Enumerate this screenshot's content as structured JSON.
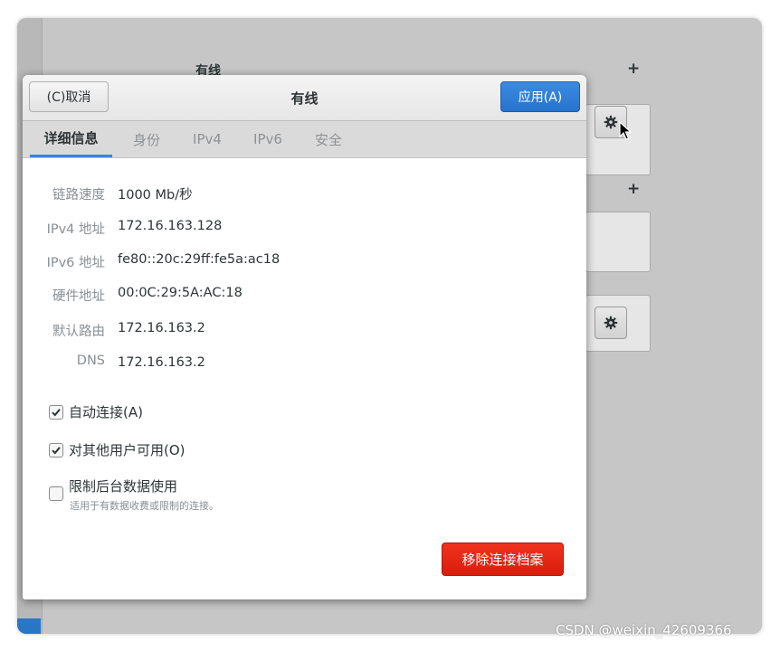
{
  "background": {
    "section_title": "有线",
    "plus_symbol": "+"
  },
  "dialog": {
    "title": "有线",
    "cancel_label": "(C)取消",
    "apply_label": "应用(A)",
    "accent_color": "#3584e4"
  },
  "tabs": [
    {
      "label": "详细信息",
      "active": true
    },
    {
      "label": "身份",
      "active": false
    },
    {
      "label": "IPv4",
      "active": false
    },
    {
      "label": "IPv6",
      "active": false
    },
    {
      "label": "安全",
      "active": false
    }
  ],
  "details": [
    {
      "label": "链路速度",
      "value": "1000 Mb/秒"
    },
    {
      "label": "IPv4 地址",
      "value": "172.16.163.128"
    },
    {
      "label": "IPv6 地址",
      "value": "fe80::20c:29ff:fe5a:ac18"
    },
    {
      "label": "硬件地址",
      "value": "00:0C:29:5A:AC:18"
    },
    {
      "label": "默认路由",
      "value": "172.16.163.2"
    },
    {
      "label": "DNS",
      "value": "172.16.163.2"
    }
  ],
  "options": {
    "auto_connect": {
      "label": "自动连接(A)",
      "checked": true
    },
    "all_users": {
      "label": "对其他用户可用(O)",
      "checked": true
    },
    "metered": {
      "label": "限制后台数据使用",
      "sublabel": "适用于有数据收费或限制的连接。",
      "checked": false
    }
  },
  "remove_label": "移除连接档案",
  "remove_color": "#e01b24",
  "watermark": "CSDN @weixin_42609366",
  "icons": [
    "gear-icon",
    "checkmark-icon",
    "mouse-pointer-icon"
  ]
}
